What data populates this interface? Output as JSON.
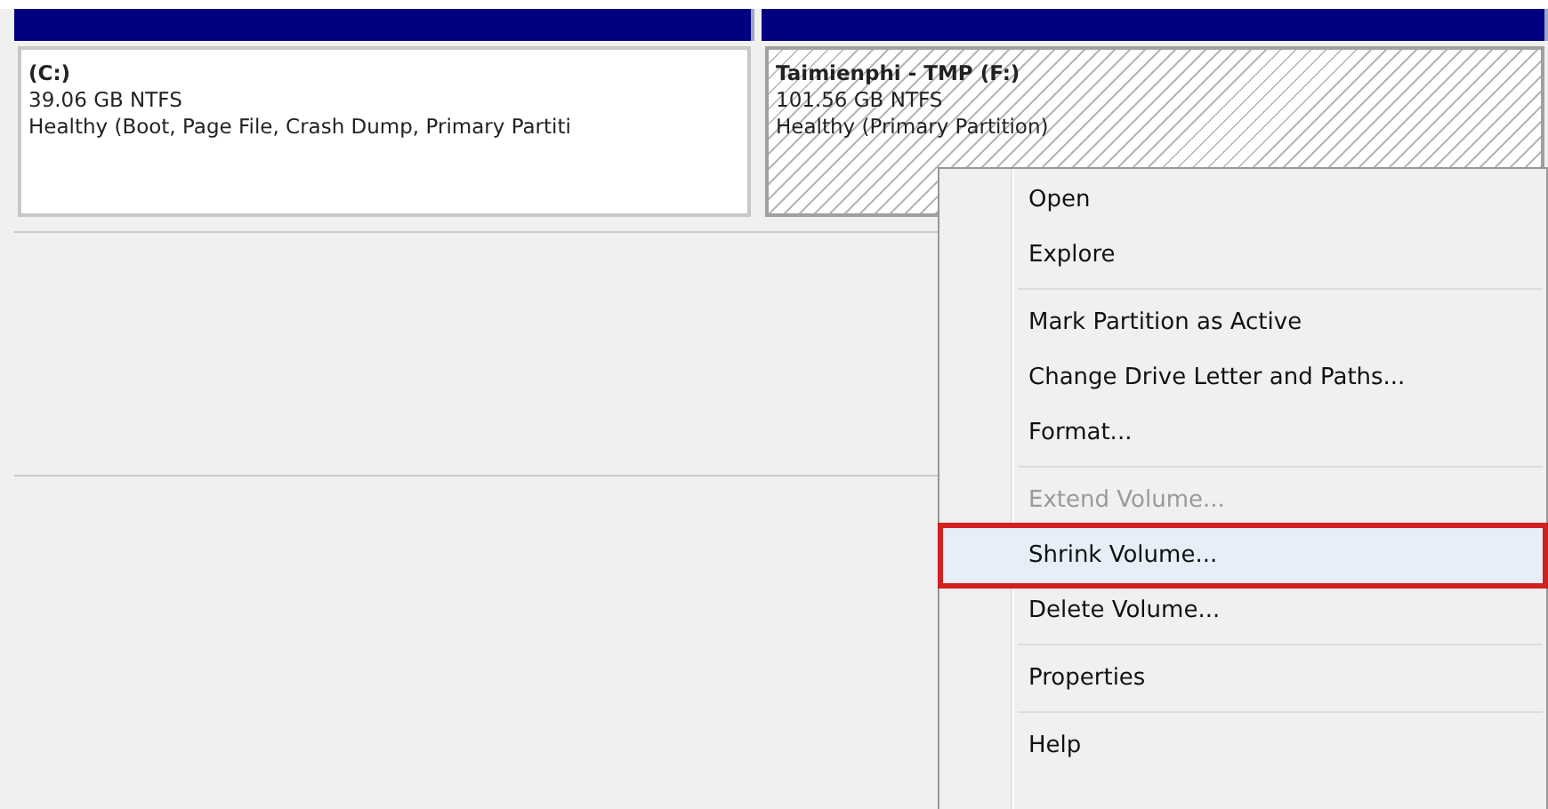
{
  "partitions": [
    {
      "label": "(C:)",
      "size": "39.06 GB NTFS",
      "status": "Healthy (Boot, Page File, Crash Dump, Primary Partiti",
      "selected": false
    },
    {
      "label": "Taimienphi - TMP (F:)",
      "size": "101.56 GB NTFS",
      "status": "Healthy (Primary Partition)",
      "selected": true
    }
  ],
  "context_menu": {
    "items": [
      {
        "kind": "item",
        "label": "Open",
        "disabled": false,
        "highlighted": false,
        "annotated": false
      },
      {
        "kind": "item",
        "label": "Explore",
        "disabled": false,
        "highlighted": false,
        "annotated": false
      },
      {
        "kind": "separator"
      },
      {
        "kind": "item",
        "label": "Mark Partition as Active",
        "disabled": false,
        "highlighted": false,
        "annotated": false
      },
      {
        "kind": "item",
        "label": "Change Drive Letter and Paths...",
        "disabled": false,
        "highlighted": false,
        "annotated": false
      },
      {
        "kind": "item",
        "label": "Format...",
        "disabled": false,
        "highlighted": false,
        "annotated": false
      },
      {
        "kind": "separator"
      },
      {
        "kind": "item",
        "label": "Extend Volume...",
        "disabled": true,
        "highlighted": false,
        "annotated": false
      },
      {
        "kind": "item",
        "label": "Shrink Volume...",
        "disabled": false,
        "highlighted": true,
        "annotated": true
      },
      {
        "kind": "item",
        "label": "Delete Volume...",
        "disabled": false,
        "highlighted": false,
        "annotated": false
      },
      {
        "kind": "separator"
      },
      {
        "kind": "item",
        "label": "Properties",
        "disabled": false,
        "highlighted": false,
        "annotated": false
      },
      {
        "kind": "separator"
      },
      {
        "kind": "item",
        "label": "Help",
        "disabled": false,
        "highlighted": false,
        "annotated": false
      }
    ]
  }
}
